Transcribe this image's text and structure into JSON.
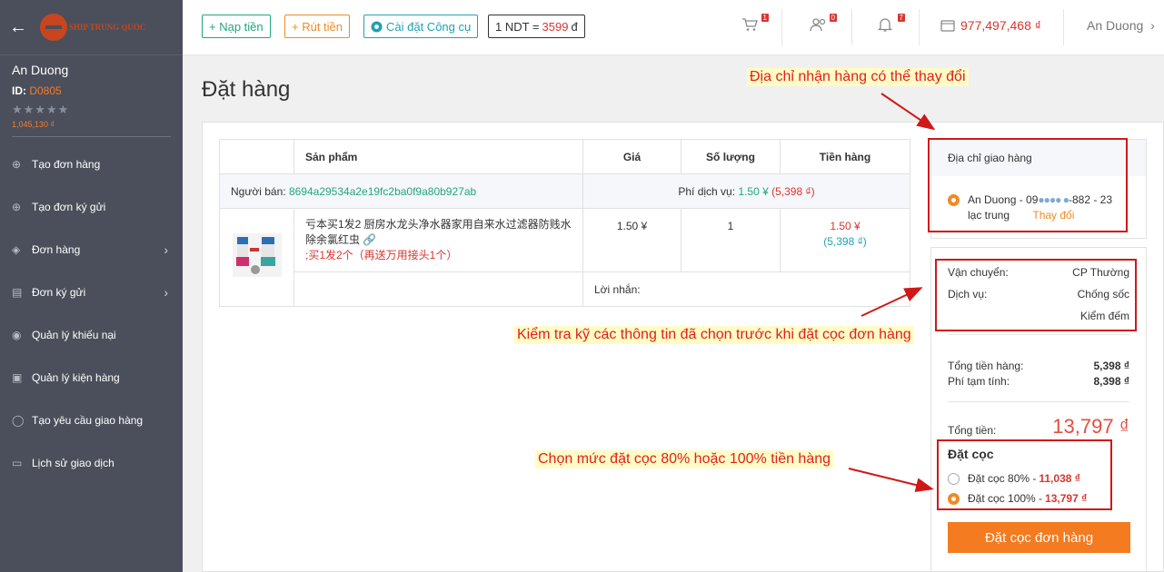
{
  "sidebar": {
    "logo_text": "SHIP TRUNG QUOC",
    "user_name": "An Duong",
    "id_label": "ID:",
    "id_value": "D0805",
    "stars": "★★★★★",
    "balance": "1,045,130 ₫",
    "items": [
      {
        "label": "Tạo đơn hàng",
        "icon": "plus-circle-icon"
      },
      {
        "label": "Tạo đơn ký gửi",
        "icon": "plus-circle-icon"
      },
      {
        "label": "Đơn hàng",
        "icon": "tag-icon",
        "chevron": true
      },
      {
        "label": "Đơn ký gửi",
        "icon": "truck-icon",
        "chevron": true
      },
      {
        "label": "Quản lý khiếu nại",
        "icon": "eye-icon"
      },
      {
        "label": "Quản lý kiện hàng",
        "icon": "package-icon"
      },
      {
        "label": "Tạo yêu cầu giao hàng",
        "icon": "cart-icon"
      },
      {
        "label": "Lịch sử giao dịch",
        "icon": "card-icon"
      }
    ]
  },
  "topbar": {
    "nap_tien": "+ Nạp tiền",
    "rut_tien": "+ Rút tiền",
    "cai_dat": "Cài đặt Công cụ",
    "rate_prefix": "1 NDT =",
    "rate_value": "3599",
    "rate_unit": "đ",
    "cart_badge": "1",
    "users_badge": "0",
    "bell_badge": "7",
    "wallet": "977,497,468 ₫",
    "user": "An Duong"
  },
  "page_title": "Đặt hàng",
  "table": {
    "headers": [
      "Sản phẩm",
      "Giá",
      "Số lượng",
      "Tiền hàng"
    ],
    "seller_label": "Người bán:",
    "seller_id": "8694a29534a2e19fc2ba0f9a80b927ab",
    "fee_label": "Phí dịch vụ:",
    "fee_cny": "1.50 ¥",
    "fee_vnd": "(5,398 ₫)",
    "product_title": "亏本买1发2 厨房水龙头净水器家用自来水过滤器防贱水除余氯红虫",
    "product_variant": ";买1发2个（再送万用接头1个）",
    "price": "1.50 ¥",
    "quantity": "1",
    "amount_cny": "1.50 ¥",
    "amount_vnd_open": "(",
    "amount_vnd": "5,398 ₫",
    "amount_vnd_close": ")",
    "message_label": "Lời nhắn:"
  },
  "address": {
    "title": "Địa chỉ giao hàng",
    "line1": "An Duong - 09",
    "masked": "●●●● ●",
    "line1b": "-882 - 23",
    "line2": "lạc trung",
    "change": "Thay đổi"
  },
  "summary": {
    "shipping_label": "Vận chuyển:",
    "shipping_value": "CP Thường",
    "service_label": "Dịch vụ:",
    "service_value1": "Chống sốc",
    "service_value2": "Kiểm đếm",
    "goods_label": "Tổng tiền hàng:",
    "goods_value": "5,398 ₫",
    "fee_label": "Phí tạm tính:",
    "fee_value": "8,398 ₫",
    "total_label": "Tổng tiền:",
    "total_value": "13,797 ₫",
    "deposit_title": "Đặt cọc",
    "dep80_label": "Đặt cọc 80% - ",
    "dep80_value": "11,038 ₫",
    "dep100_label": "Đặt cọc 100% - ",
    "dep100_value": "13,797 ₫",
    "deposit_button": "Đặt cọc đơn hàng"
  },
  "annotations": {
    "addr_note": "Địa chỉ nhận hàng có thể thay đổi",
    "check_note": "Kiểm tra kỹ các thông tin đã chọn trước khi đặt cọc đơn hàng",
    "deposit_note": "Chọn mức đặt cọc 80% hoặc 100% tiền hàng"
  },
  "colors": {
    "accent_orange": "#f47b20",
    "red": "#d6362f",
    "green": "#22a67e",
    "annotation_red": "#d01818",
    "annotation_bg": "#fffcc5"
  }
}
